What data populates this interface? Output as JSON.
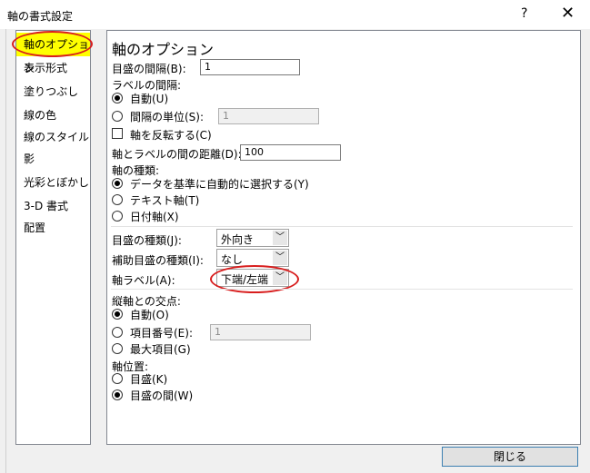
{
  "window": {
    "title": "軸の書式設定",
    "help_label": "?",
    "close_label": "✕"
  },
  "categories": [
    {
      "label": "軸のオプション",
      "selected": true
    },
    {
      "label": "表示形式"
    },
    {
      "label": "塗りつぶし"
    },
    {
      "label": "線の色"
    },
    {
      "label": "線のスタイル"
    },
    {
      "label": "影"
    },
    {
      "label": "光彩とぼかし"
    },
    {
      "label": "3-D 書式"
    },
    {
      "label": "配置"
    }
  ],
  "panel": {
    "title": "軸のオプション",
    "major_unit": {
      "label": "目盛の間隔(B):",
      "value": "1"
    },
    "label_interval": {
      "label": "ラベルの間隔:",
      "auto": "自動(U)",
      "unit": "間隔の単位(S):",
      "unit_value": "1"
    },
    "reverse": "軸を反転する(C)",
    "distance": {
      "label": "軸とラベルの間の距離(D):",
      "value": "100"
    },
    "axis_type": {
      "label": "軸の種類:",
      "options": [
        "データを基準に自動的に選択する(Y)",
        "テキスト軸(T)",
        "日付軸(X)"
      ]
    },
    "major_tick": {
      "label": "目盛の種類(J):",
      "value": "外向き"
    },
    "minor_tick": {
      "label": "補助目盛の種類(I):",
      "value": "なし"
    },
    "axis_label": {
      "label": "軸ラベル(A):",
      "value": "下端/左端"
    },
    "crosses": {
      "label": "縦軸との交点:",
      "auto": "自動(O)",
      "category_number": "項目番号(E):",
      "category_number_value": "1",
      "max": "最大項目(G)"
    },
    "position": {
      "label": "軸位置:",
      "on_ticks": "目盛(K)",
      "between": "目盛の間(W)"
    }
  },
  "footer": {
    "close_button": "閉じる"
  },
  "colors": {
    "highlight": "#ffff00",
    "annotation": "#d81e1e"
  }
}
